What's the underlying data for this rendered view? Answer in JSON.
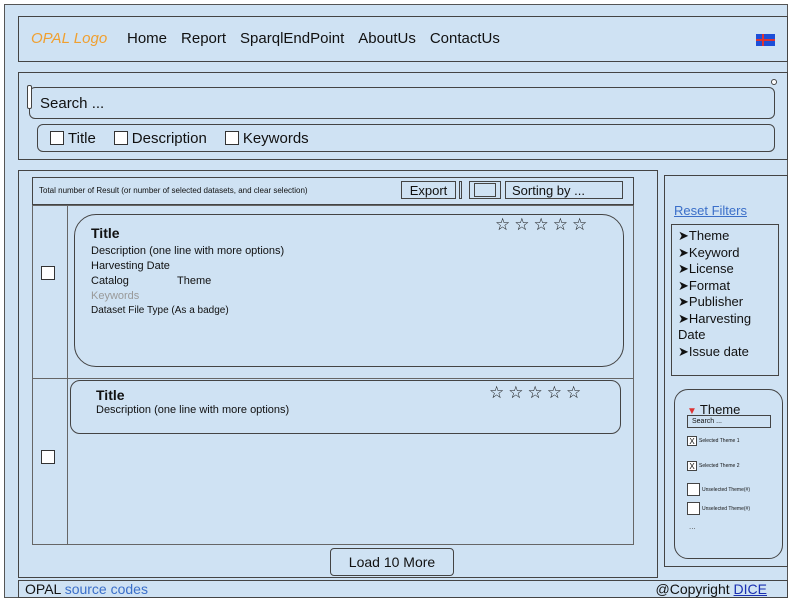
{
  "nav": {
    "logo": "OPAL Logo",
    "links": [
      "Home",
      "Report",
      "SparqlEndPoint",
      "AboutUs",
      "ContactUs"
    ]
  },
  "search": {
    "placeholder": "Search ...",
    "filters": [
      "Title",
      "Description",
      "Keywords"
    ]
  },
  "results": {
    "info": "Total number of Result (or number of selected datasets, and clear selection)",
    "export_label": "Export",
    "sorting_label": "Sorting by ..."
  },
  "cards": [
    {
      "title": "Title",
      "description": "Description (one line with more options)",
      "harvesting": "Harvesting Date",
      "catalog": "Catalog",
      "theme": "Theme",
      "keywords": "Keywords",
      "filetype": "Dataset File Type (As a badge)",
      "stars": "☆☆☆☆☆"
    },
    {
      "title": "Title",
      "description": "Description (one line with more options)",
      "stars": "☆☆☆☆☆"
    }
  ],
  "load_more": "Load 10 More",
  "sidebar": {
    "reset": "Reset Filters",
    "facets": [
      "Theme",
      "Keyword",
      "License",
      "Format",
      "Publisher",
      "Harvesting Date",
      "Issue date"
    ],
    "theme_panel": {
      "title": "Theme",
      "search": "Search ...",
      "items": [
        {
          "label": "Selected Theme 1",
          "checked": true
        },
        {
          "label": "Selected Theme 2",
          "checked": true
        },
        {
          "label": "Unselected Theme(#)",
          "checked": false
        },
        {
          "label": "Unselected Theme(#)",
          "checked": false
        }
      ],
      "more": "..."
    }
  },
  "footer": {
    "brand": "OPAL",
    "source": "source codes",
    "copyright": "@Copyright",
    "org": "DICE"
  },
  "colors": {
    "background": "#cfe2f3",
    "logo": "#f0a030",
    "link": "#3b6fc9"
  }
}
